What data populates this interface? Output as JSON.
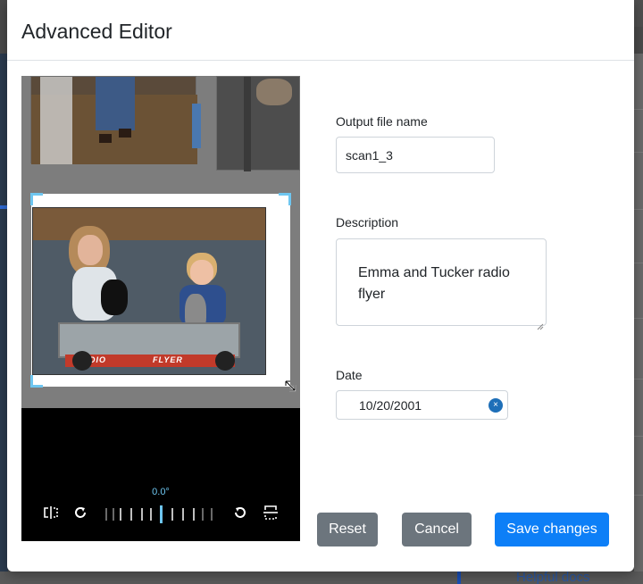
{
  "modal": {
    "title": "Advanced Editor"
  },
  "editor": {
    "rotation_label": "0.0°",
    "photo_text": {
      "wagon_left": "RADIO",
      "wagon_right": "FLYER"
    },
    "icons": {
      "flip_horizontal": "flip-horizontal-icon",
      "rotate_right": "rotate-clockwise-icon",
      "rotate_left": "rotate-counterclockwise-icon",
      "flip_vertical": "flip-vertical-icon"
    }
  },
  "form": {
    "output_label": "Output file name",
    "output_value": "scan1_3",
    "description_label": "Description",
    "description_value": "Emma and Tucker radio flyer",
    "date_label": "Date",
    "date_value": "10/20/2001"
  },
  "footer": {
    "reset_label": "Reset",
    "cancel_label": "Cancel",
    "save_label": "Save changes"
  },
  "background": {
    "helpful_text": "Helpful docs"
  },
  "colors": {
    "accent": "#0d7ff7",
    "secondary": "#6c757d",
    "crop_handle": "#6ec6f0"
  }
}
